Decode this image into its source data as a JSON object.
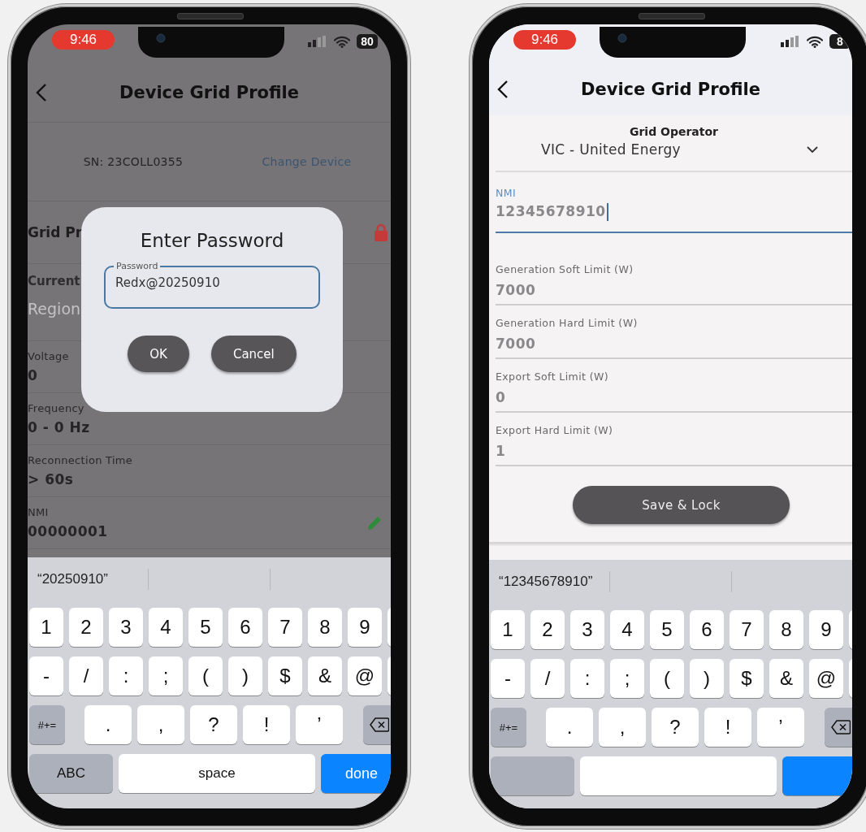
{
  "left_phone": {
    "status_bar": {
      "time": "9:46",
      "battery": "80"
    },
    "header": {
      "title": "Device Grid Profile"
    },
    "device": {
      "serial": "SN: 23COLL0355",
      "change_link": "Change Device"
    },
    "section": {
      "title": "Grid Pr",
      "locked": true
    },
    "current": {
      "label": "Current",
      "placeholder": "Region"
    },
    "fields": [
      {
        "label": "Voltage",
        "value": "0",
        "editable": false
      },
      {
        "label": "Frequency",
        "value": "0 - 0 Hz",
        "editable": false
      },
      {
        "label": "Reconnection Time",
        "value": "> 60s",
        "editable": false
      },
      {
        "label": "NMI",
        "value": "00000001",
        "editable": true
      }
    ],
    "dialog": {
      "title": "Enter Password",
      "field": {
        "label": "Password",
        "value": "Redx@20250910"
      },
      "buttons": [
        {
          "label": "OK"
        },
        {
          "label": "Cancel"
        }
      ]
    },
    "keyboard": {
      "suggestion": "“20250910”",
      "rows": [
        {
          "keys": [
            {
              "kind": "char",
              "label": "1"
            },
            {
              "kind": "char",
              "label": "2"
            },
            {
              "kind": "char",
              "label": "3"
            },
            {
              "kind": "char",
              "label": "4"
            },
            {
              "kind": "char",
              "label": "5"
            },
            {
              "kind": "char",
              "label": "6"
            },
            {
              "kind": "char",
              "label": "7"
            },
            {
              "kind": "char",
              "label": "8"
            },
            {
              "kind": "char",
              "label": "9"
            },
            {
              "kind": "partial"
            }
          ]
        },
        {
          "keys": [
            {
              "kind": "char",
              "label": "-"
            },
            {
              "kind": "char",
              "label": "/"
            },
            {
              "kind": "char",
              "label": ":"
            },
            {
              "kind": "char",
              "label": ";"
            },
            {
              "kind": "char",
              "label": "("
            },
            {
              "kind": "char",
              "label": ")"
            },
            {
              "kind": "char",
              "label": "$"
            },
            {
              "kind": "char",
              "label": "&"
            },
            {
              "kind": "char",
              "label": "@"
            },
            {
              "kind": "partial"
            }
          ]
        },
        {
          "keys": [
            {
              "kind": "function",
              "label": "#+="
            },
            {
              "kind": "char",
              "label": "."
            },
            {
              "kind": "char",
              "label": ","
            },
            {
              "kind": "char",
              "label": "?"
            },
            {
              "kind": "char",
              "label": "!"
            },
            {
              "kind": "char",
              "label": "’"
            },
            {
              "kind": "delete"
            }
          ]
        },
        {
          "keys": [
            {
              "kind": "function",
              "label": "ABC"
            },
            {
              "kind": "space",
              "label": "space"
            },
            {
              "kind": "done",
              "label": "done"
            }
          ]
        }
      ]
    }
  },
  "right_phone": {
    "status_bar": {
      "time": "9:46",
      "battery": "8"
    },
    "header": {
      "title": "Device Grid Profile"
    },
    "grid_operator": {
      "label": "Grid Operator",
      "value": "VIC - United Energy"
    },
    "fields": [
      {
        "label": "NMI",
        "value": "12345678910",
        "focused": true
      },
      {
        "label": "Generation Soft Limit (W)",
        "value": "7000",
        "focused": false
      },
      {
        "label": "Generation Hard Limit (W)",
        "value": "7000",
        "focused": false
      },
      {
        "label": "Export Soft Limit (W)",
        "value": "0",
        "focused": false
      },
      {
        "label": "Export Hard Limit (W)",
        "value": "1",
        "focused": false
      }
    ],
    "save_button": {
      "label": "Save & Lock"
    },
    "keyboard": {
      "suggestion": "“12345678910”",
      "rows": [
        {
          "keys": [
            {
              "kind": "char",
              "label": "1"
            },
            {
              "kind": "char",
              "label": "2"
            },
            {
              "kind": "char",
              "label": "3"
            },
            {
              "kind": "char",
              "label": "4"
            },
            {
              "kind": "char",
              "label": "5"
            },
            {
              "kind": "char",
              "label": "6"
            },
            {
              "kind": "char",
              "label": "7"
            },
            {
              "kind": "char",
              "label": "8"
            },
            {
              "kind": "char",
              "label": "9"
            },
            {
              "kind": "partial"
            }
          ]
        },
        {
          "keys": [
            {
              "kind": "char",
              "label": "-"
            },
            {
              "kind": "char",
              "label": "/"
            },
            {
              "kind": "char",
              "label": ":"
            },
            {
              "kind": "char",
              "label": ";"
            },
            {
              "kind": "char",
              "label": "("
            },
            {
              "kind": "char",
              "label": ")"
            },
            {
              "kind": "char",
              "label": "$"
            },
            {
              "kind": "char",
              "label": "&"
            },
            {
              "kind": "char",
              "label": "@"
            },
            {
              "kind": "partial"
            }
          ]
        },
        {
          "keys": [
            {
              "kind": "function",
              "label": "#+="
            },
            {
              "kind": "char",
              "label": "."
            },
            {
              "kind": "char",
              "label": ","
            },
            {
              "kind": "char",
              "label": "?"
            },
            {
              "kind": "char",
              "label": "!"
            },
            {
              "kind": "char",
              "label": "’"
            },
            {
              "kind": "delete"
            }
          ]
        },
        {
          "keys": [
            {
              "kind": "function"
            },
            {
              "kind": "space"
            },
            {
              "kind": "done"
            }
          ]
        }
      ]
    }
  }
}
